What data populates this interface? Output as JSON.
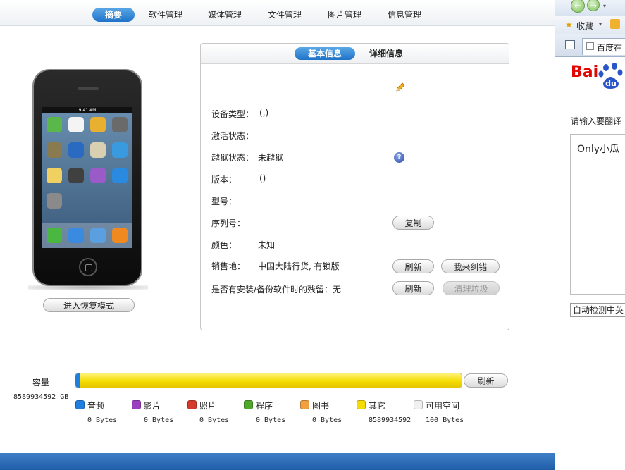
{
  "nav": {
    "tabs": [
      {
        "label": "摘要",
        "active": true
      },
      {
        "label": "软件管理"
      },
      {
        "label": "媒体管理"
      },
      {
        "label": "文件管理"
      },
      {
        "label": "图片管理"
      },
      {
        "label": "信息管理"
      }
    ]
  },
  "device": {
    "status_time": "9:41 AM",
    "recovery_button": "进入恢复模式"
  },
  "info_panel": {
    "tabs": [
      {
        "label": "基本信息",
        "active": true
      },
      {
        "label": "详细信息"
      }
    ],
    "rows": {
      "device_type": {
        "label": "设备类型：",
        "value": "(,)"
      },
      "activation": {
        "label": "激活状态：",
        "value": ""
      },
      "jailbreak": {
        "label": "越狱状态：",
        "value": "未越狱"
      },
      "version": {
        "label": "版本：",
        "value": "()"
      },
      "model": {
        "label": "型号：",
        "value": ""
      },
      "serial": {
        "label": "序列号：",
        "value": ""
      },
      "color": {
        "label": "颜色：",
        "value": "未知"
      },
      "region": {
        "label": "销售地：",
        "value": "中国大陆行货, 有锁版"
      },
      "residual": {
        "label": "是否有安装/备份软件时的残留：",
        "value": "无"
      }
    },
    "buttons": {
      "copy": "复制",
      "refresh_region": "刷新",
      "report_error": "我来纠错",
      "refresh_residual": "刷新",
      "clean_junk": "清理垃圾"
    }
  },
  "capacity": {
    "label": "容量",
    "total": "8589934592 GB",
    "refresh_button": "刷新",
    "segments": [
      {
        "name": "音频",
        "color": "#1f7fe0",
        "size": "0 Bytes",
        "fraction": 0.012
      },
      {
        "name": "影片",
        "color": "#9b3fc0",
        "size": "0 Bytes",
        "fraction": 0.0
      },
      {
        "name": "照片",
        "color": "#d63a2a",
        "size": "0 Bytes",
        "fraction": 0.0
      },
      {
        "name": "程序",
        "color": "#4ea82a",
        "size": "0 Bytes",
        "fraction": 0.0
      },
      {
        "name": "图书",
        "color": "#f0a040",
        "size": "0 Bytes",
        "fraction": 0.0
      },
      {
        "name": "其它",
        "color": "#f5dc00",
        "size": "8589934592",
        "fraction": 0.988
      },
      {
        "name": "可用空间",
        "color": "#f0f0f0",
        "size": "100 Bytes",
        "fraction": 0.0
      }
    ]
  },
  "browser": {
    "favorites": "收藏",
    "tab_title": "百度在",
    "logo_text": "Bai",
    "paw_text": "du",
    "prompt": "请输入要翻译",
    "input_value": "Only小瓜",
    "detect_option": "自动检测中英"
  }
}
